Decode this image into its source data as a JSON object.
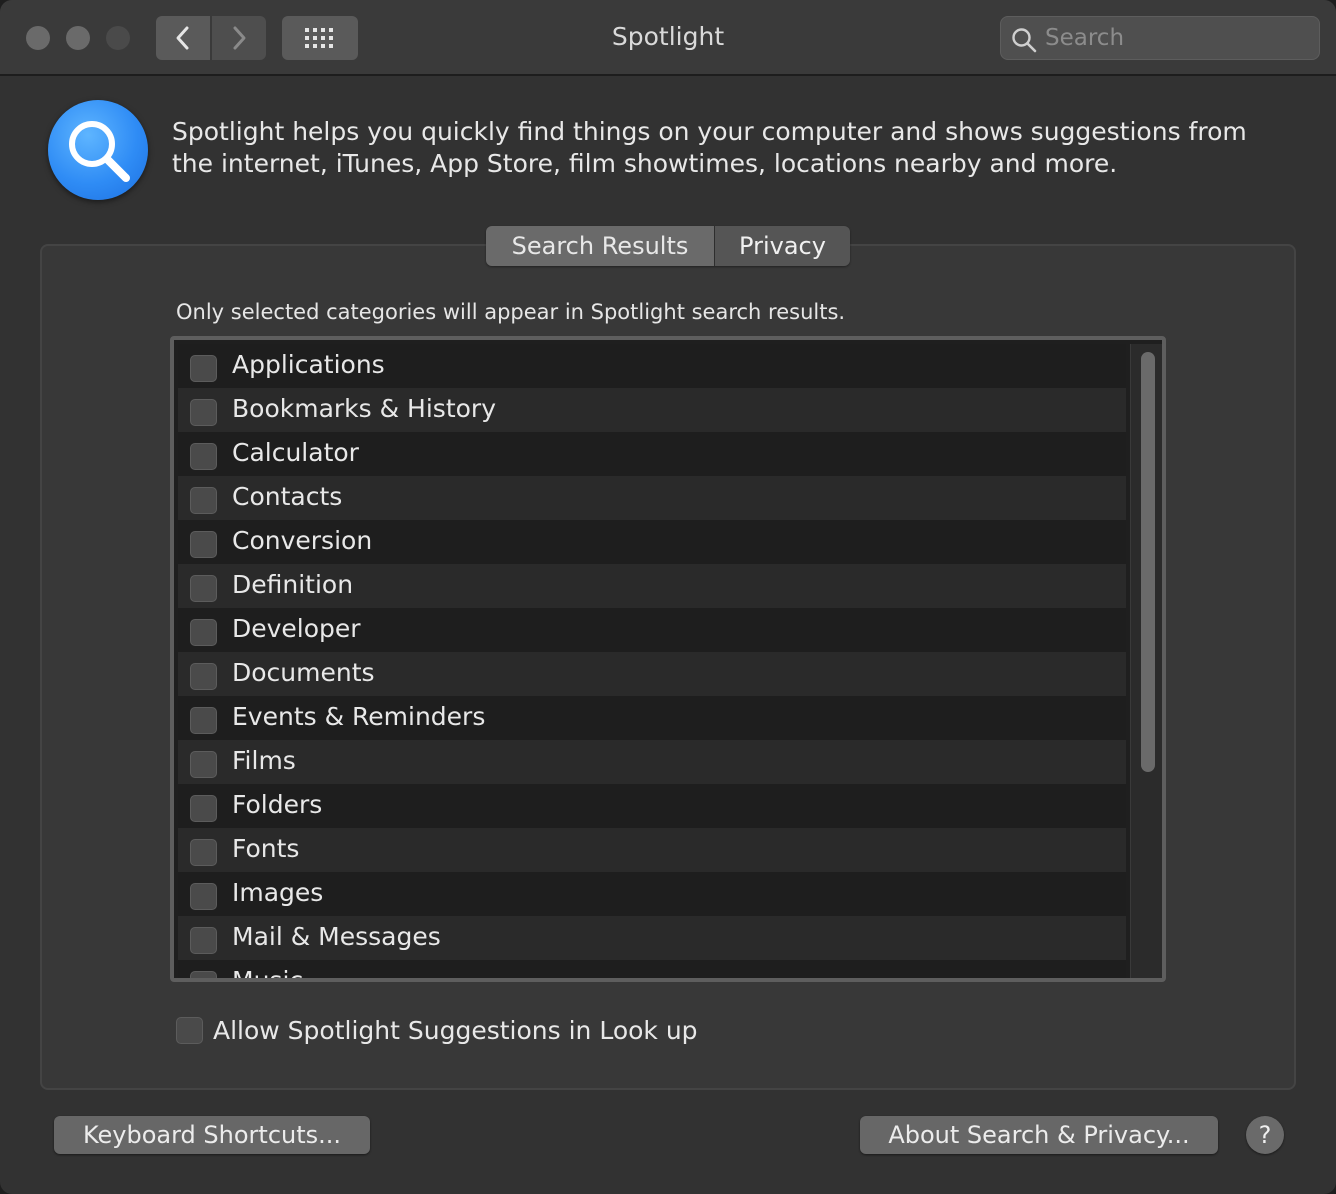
{
  "window": {
    "title": "Spotlight",
    "search": {
      "placeholder": "Search",
      "value": ""
    }
  },
  "header": {
    "icon": "spotlight-magnifier-icon",
    "description": "Spotlight helps you quickly find things on your computer and shows suggestions from the internet, iTunes, App Store, film showtimes, locations nearby and more."
  },
  "tabs": [
    {
      "label": "Search Results",
      "selected": true
    },
    {
      "label": "Privacy",
      "selected": false
    }
  ],
  "categories": {
    "hint": "Only selected categories will appear in Spotlight search results.",
    "items": [
      {
        "label": "Applications",
        "checked": false
      },
      {
        "label": "Bookmarks & History",
        "checked": false
      },
      {
        "label": "Calculator",
        "checked": false
      },
      {
        "label": "Contacts",
        "checked": false
      },
      {
        "label": "Conversion",
        "checked": false
      },
      {
        "label": "Definition",
        "checked": false
      },
      {
        "label": "Developer",
        "checked": false
      },
      {
        "label": "Documents",
        "checked": false
      },
      {
        "label": "Events & Reminders",
        "checked": false
      },
      {
        "label": "Films",
        "checked": false
      },
      {
        "label": "Folders",
        "checked": false
      },
      {
        "label": "Fonts",
        "checked": false
      },
      {
        "label": "Images",
        "checked": false
      },
      {
        "label": "Mail & Messages",
        "checked": false
      },
      {
        "label": "Music",
        "checked": false
      }
    ]
  },
  "allow_suggestions": {
    "label": "Allow Spotlight Suggestions in Look up",
    "checked": false
  },
  "footer": {
    "keyboard_shortcuts": "Keyboard Shortcuts...",
    "about": "About Search & Privacy...",
    "help": "?"
  }
}
